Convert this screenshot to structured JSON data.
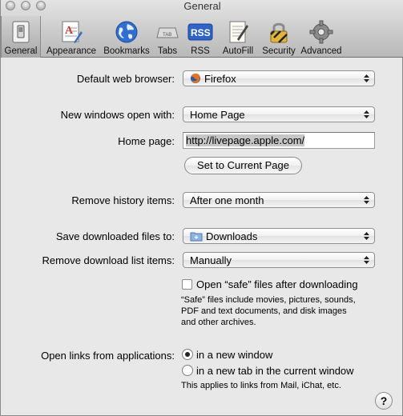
{
  "window": {
    "title": "General"
  },
  "toolbar": {
    "items": [
      {
        "label": "General",
        "icon": "general-switch-icon",
        "active": true
      },
      {
        "label": "Appearance",
        "icon": "appearance-icon"
      },
      {
        "label": "Bookmarks",
        "icon": "globe-icon"
      },
      {
        "label": "Tabs",
        "icon": "tab-icon",
        "badge": "TAB"
      },
      {
        "label": "RSS",
        "icon": "rss-icon",
        "badge": "RSS"
      },
      {
        "label": "AutoFill",
        "icon": "autofill-icon"
      },
      {
        "label": "Security",
        "icon": "lock-icon"
      },
      {
        "label": "Advanced",
        "icon": "gear-icon"
      }
    ]
  },
  "settings": {
    "default_browser": {
      "label": "Default web browser:",
      "value": "Firefox"
    },
    "new_windows": {
      "label": "New windows open with:",
      "value": "Home Page"
    },
    "home_page": {
      "label": "Home page:",
      "value": "http://livepage.apple.com/"
    },
    "set_current_button": "Set to Current Page",
    "remove_history": {
      "label": "Remove history items:",
      "value": "After one month"
    },
    "save_downloads": {
      "label": "Save downloaded files to:",
      "value": "Downloads"
    },
    "remove_download_list": {
      "label": "Remove download list items:",
      "value": "Manually"
    },
    "open_safe": {
      "label": "Open “safe” files after downloading",
      "checked": false,
      "note_line1": "“Safe” files include movies, pictures, sounds,",
      "note_line2": "PDF and text documents, and disk images",
      "note_line3": "and other archives."
    },
    "open_links": {
      "label": "Open links from applications:",
      "option_window": "in a new window",
      "option_tab": "in a new tab in the current window",
      "selected": "in a new window",
      "note": "This applies to links from Mail, iChat, etc."
    },
    "help_label": "?"
  }
}
